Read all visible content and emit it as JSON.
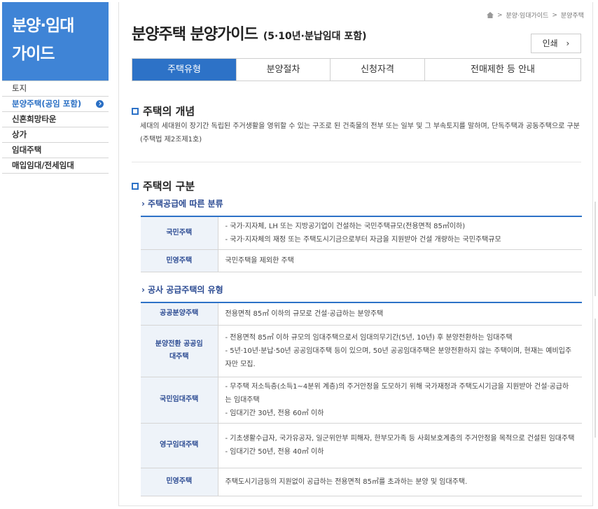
{
  "sidebar": {
    "title_line1": "분양·임대",
    "title_line2": "가이드",
    "items": [
      {
        "label": "토지"
      },
      {
        "label": "분양주택(공임 포함)"
      },
      {
        "label": "신혼희망타운"
      },
      {
        "label": "상가"
      },
      {
        "label": "임대주택"
      },
      {
        "label": "매입임대/전세임대"
      }
    ]
  },
  "breadcrumb": {
    "level1": "분양·임대가이드",
    "level2": "분양주택"
  },
  "page": {
    "title": "분양주택 분양가이드",
    "subtitle": "(5·10년·분납임대 포함)",
    "print_label": "인쇄"
  },
  "tabs": [
    {
      "label": "주택유형"
    },
    {
      "label": "분양절차"
    },
    {
      "label": "신청자격"
    },
    {
      "label": "전매제한 등 안내"
    }
  ],
  "concept": {
    "heading": "주택의 개념",
    "text": "세대의 세대원이 장기간 독립된 주거생활을 영위할 수 있는 구조로 된 건축물의 전부 또는 일부 및 그 부속토지를 말하며, 단독주택과 공동주택으로 구분(주택법 제2조제1호)"
  },
  "classification": {
    "heading": "주택의 구분",
    "supply": {
      "subheading": "주택공급에 따른 분류",
      "rows": [
        {
          "type": "국민주택",
          "lines": [
            "- 국가·지자체, LH 또는 지방공기업이 건설하는 국민주택규모(전용면적 85㎡이하)",
            "- 국가·지자체의 재정 또는 주택도시기금으로부터 자금을 지원받아 건설 개량하는 국민주택규모"
          ]
        },
        {
          "type": "민영주택",
          "lines": [
            "국민주택을 제외한 주택"
          ]
        }
      ]
    },
    "public": {
      "subheading": "공사 공급주택의 유형",
      "rows": [
        {
          "type": "공공분양주택",
          "lines": [
            "전용면적 85㎡ 이하의 규모로 건설·공급하는 분양주택"
          ]
        },
        {
          "type": "분양전환 공공임대주택",
          "lines": [
            "- 전용면적 85㎡ 이하 규모의 임대주택으로서 임대의무기간(5년, 10년) 후 분양전환하는 임대주택",
            "- 5년·10년·분납·50년 공공임대주택 등이 있으며, 50년 공공임대주택은 분양전환하지 않는 주택이며, 현재는 예비입주자만 모집."
          ]
        },
        {
          "type": "국민임대주택",
          "lines": [
            "- 무주택 저소득층(소득1~4분위 계층)의 주거안정을 도모하기 위해 국가재정과 주택도시기금을 지원받아 건설·공급하는 임대주택",
            "- 임대기간 30년, 전용 60㎡ 이하"
          ]
        },
        {
          "type": "영구임대주택",
          "lines": [
            "- 기초생활수급자, 국가유공자, 일군위안부 피해자, 한부모가족 등 사회보호계층의 주거안정을 목적으로 건설된 임대주택",
            "- 임대기간 50년, 전용 40㎡ 이하"
          ]
        },
        {
          "type": "민영주택",
          "lines": [
            "주택도시기금등의 지원없이 공급하는 전용면적 85㎡를 초과하는 분양 및 임대주택."
          ]
        }
      ]
    }
  }
}
